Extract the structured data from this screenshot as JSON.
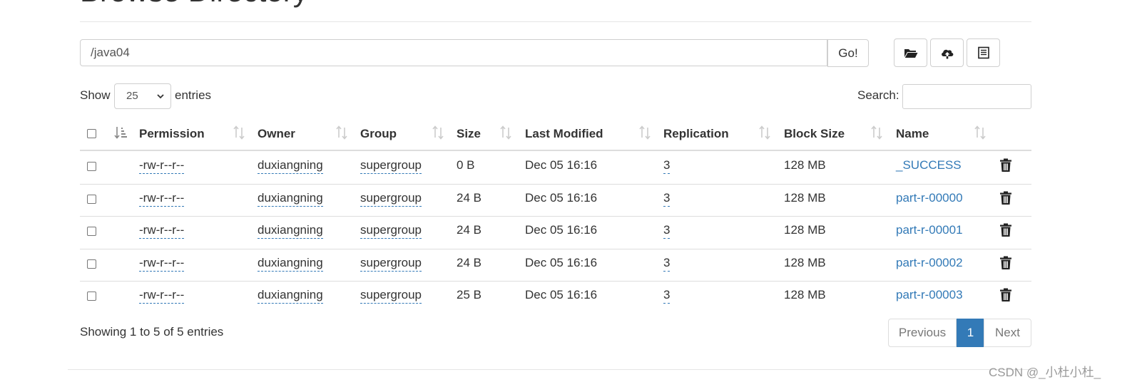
{
  "page": {
    "title": "Browse Directory"
  },
  "path_bar": {
    "path_value": "/java04",
    "go_label": "Go!"
  },
  "toolbar_icons": [
    "folder-open-icon",
    "cloud-upload-icon",
    "list-icon"
  ],
  "length_control": {
    "show_label": "Show",
    "selected": "25",
    "entries_label": "entries"
  },
  "search": {
    "label": "Search:",
    "value": ""
  },
  "table": {
    "columns": [
      "Permission",
      "Owner",
      "Group",
      "Size",
      "Last Modified",
      "Replication",
      "Block Size",
      "Name"
    ],
    "rows": [
      {
        "permission": "-rw-r--r--",
        "owner": "duxiangning",
        "group": "supergroup",
        "size": "0 B",
        "modified": "Dec 05 16:16",
        "replication": "3",
        "block_size": "128 MB",
        "name": "_SUCCESS"
      },
      {
        "permission": "-rw-r--r--",
        "owner": "duxiangning",
        "group": "supergroup",
        "size": "24 B",
        "modified": "Dec 05 16:16",
        "replication": "3",
        "block_size": "128 MB",
        "name": "part-r-00000"
      },
      {
        "permission": "-rw-r--r--",
        "owner": "duxiangning",
        "group": "supergroup",
        "size": "24 B",
        "modified": "Dec 05 16:16",
        "replication": "3",
        "block_size": "128 MB",
        "name": "part-r-00001"
      },
      {
        "permission": "-rw-r--r--",
        "owner": "duxiangning",
        "group": "supergroup",
        "size": "24 B",
        "modified": "Dec 05 16:16",
        "replication": "3",
        "block_size": "128 MB",
        "name": "part-r-00002"
      },
      {
        "permission": "-rw-r--r--",
        "owner": "duxiangning",
        "group": "supergroup",
        "size": "25 B",
        "modified": "Dec 05 16:16",
        "replication": "3",
        "block_size": "128 MB",
        "name": "part-r-00003"
      }
    ]
  },
  "footer": {
    "info": "Showing 1 to 5 of 5 entries"
  },
  "pagination": {
    "previous": "Previous",
    "current": "1",
    "next": "Next"
  },
  "watermark": "CSDN @_小杜小杜_",
  "colors": {
    "link": "#337ab7",
    "active_page": "#337ab7",
    "border": "#dddddd"
  }
}
